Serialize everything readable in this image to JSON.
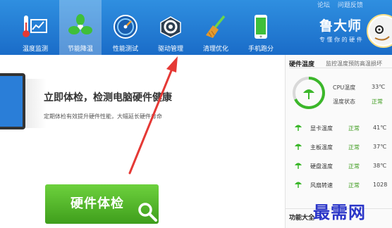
{
  "top_links": [
    "论坛",
    "问题反馈"
  ],
  "nav": [
    {
      "label": "温度监测",
      "icon": "thermometer-chart-icon"
    },
    {
      "label": "节能降温",
      "icon": "fan-icon"
    },
    {
      "label": "性能测试",
      "icon": "speedometer-icon"
    },
    {
      "label": "驱动管理",
      "icon": "driver-gear-icon"
    },
    {
      "label": "清理优化",
      "icon": "broom-icon"
    },
    {
      "label": "手机跑分",
      "icon": "phone-icon"
    }
  ],
  "brand": {
    "title": "鲁大师",
    "slogan": "专 懂 你 的 硬 件"
  },
  "main": {
    "headline": "立即体检，检测电脑硬件健康",
    "subline": "定期体检有效提升硬件性能，大幅延长硬件寿命",
    "check_button": "硬件体检"
  },
  "panel": {
    "title": "硬件温度",
    "desc": "监控温度预防高温损坏",
    "cpu_temp_label": "CPU温度",
    "cpu_temp_value": "33℃",
    "temp_state_label": "温度状态",
    "temp_state_value": "正常",
    "rows": [
      {
        "label": "显卡温度",
        "status": "正常",
        "value": "41℃"
      },
      {
        "label": "主板温度",
        "status": "正常",
        "value": "37℃"
      },
      {
        "label": "硬盘温度",
        "status": "正常",
        "value": "38℃"
      },
      {
        "label": "风扇转速",
        "status": "正常",
        "value": "1028"
      }
    ],
    "functions_title": "功能大全"
  },
  "watermark": "最需网",
  "colors": {
    "topbar": "#1f7ad4",
    "accent_green": "#4cb52a",
    "status_green": "#3a9a1a",
    "arrow_red": "#e53935"
  }
}
